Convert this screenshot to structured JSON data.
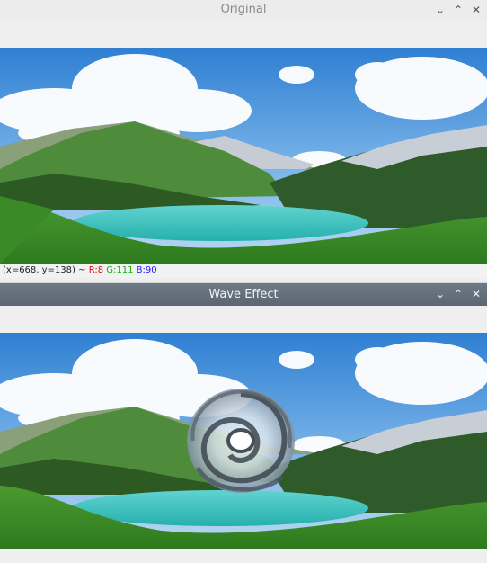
{
  "windows": {
    "original": {
      "title": "Original",
      "status": {
        "coords": "(x=668, y=138) ~",
        "r": "R:8",
        "g": "G:111",
        "b": "B:90"
      }
    },
    "wave": {
      "title": "Wave Effect"
    }
  },
  "controls": {
    "minimize": "⌄",
    "maximize": "⌃",
    "close": "✕"
  },
  "colors": {
    "sky": "#3f8fd6",
    "cloud": "#ffffff",
    "lake": "#3ac4c0",
    "grass": "#3f8f2a",
    "mountain": "#2f5a2a"
  },
  "icons": [
    "chevron-down-icon",
    "chevron-up-icon",
    "close-icon"
  ]
}
